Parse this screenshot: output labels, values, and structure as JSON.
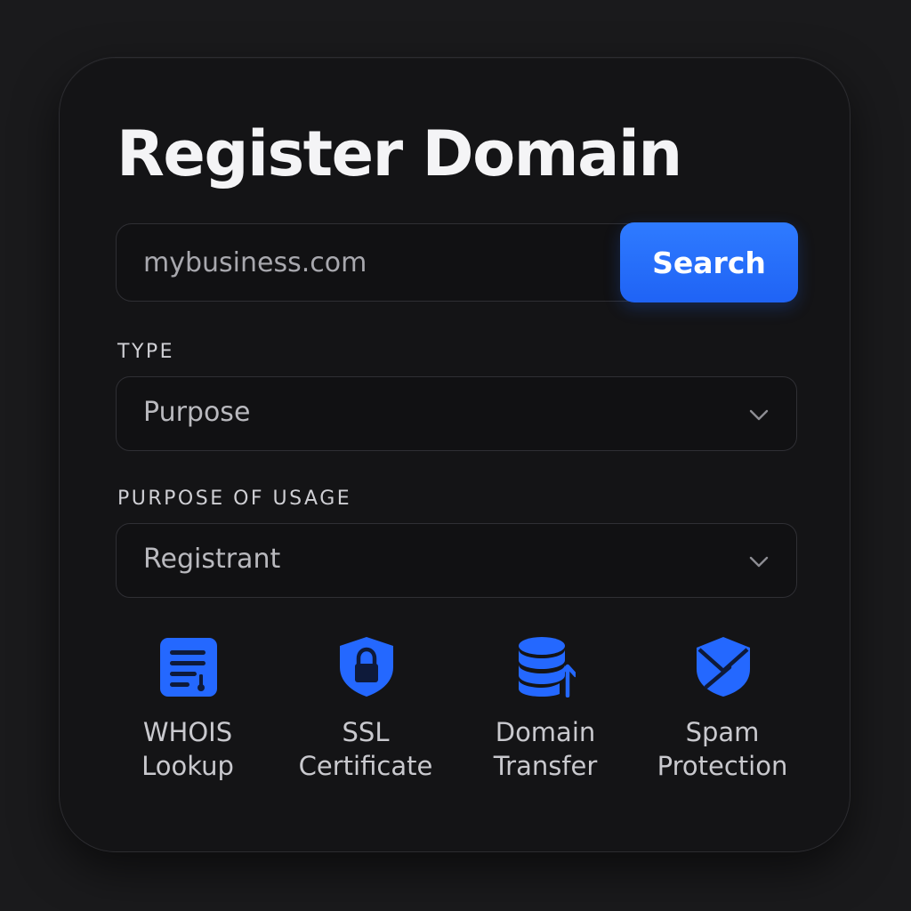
{
  "title": "Register Domain",
  "search": {
    "value": "mybusiness.com",
    "button_label": "Search"
  },
  "type_field": {
    "label": "TYPE",
    "value": "Purpose"
  },
  "usage_field": {
    "label": "PURPOSE OF USAGE",
    "value": "Registrant"
  },
  "features": [
    {
      "icon": "document-icon",
      "label": "WHOIS\nLookup"
    },
    {
      "icon": "shield-lock-icon",
      "label": "SSL\nCertificate"
    },
    {
      "icon": "database-transfer-icon",
      "label": "Domain\nTransfer"
    },
    {
      "icon": "shield-envelope-icon",
      "label": "Spam\nProtection"
    }
  ],
  "colors": {
    "background": "#1a1a1c",
    "card": "#141416",
    "accent": "#2468ff",
    "text": "#f4f4f6",
    "muted": "#b9b9be"
  }
}
